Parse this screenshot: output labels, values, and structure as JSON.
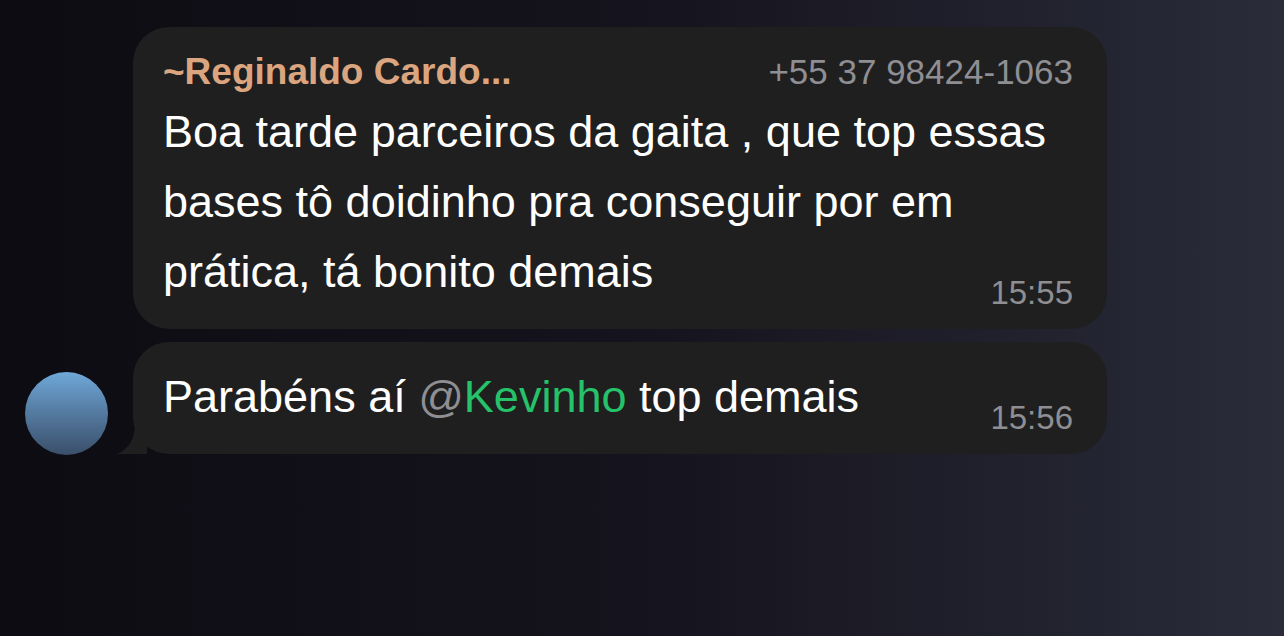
{
  "messages": [
    {
      "sender": "~Reginaldo Cardo...",
      "phone": "+55 37 98424-1063",
      "parts": [
        {
          "kind": "text",
          "text": "Boa tarde parceiros da gaita , que top essas bases tô doidinho pra conseguir por em prática, tá bonito demais"
        }
      ],
      "time": "15:55"
    },
    {
      "sender": "",
      "phone": "",
      "parts": [
        {
          "kind": "text",
          "text": "Parabéns aí "
        },
        {
          "kind": "mention",
          "at": "@",
          "text": "Kevinho"
        },
        {
          "kind": "text",
          "text": " top demais"
        }
      ],
      "time": "15:56"
    }
  ]
}
